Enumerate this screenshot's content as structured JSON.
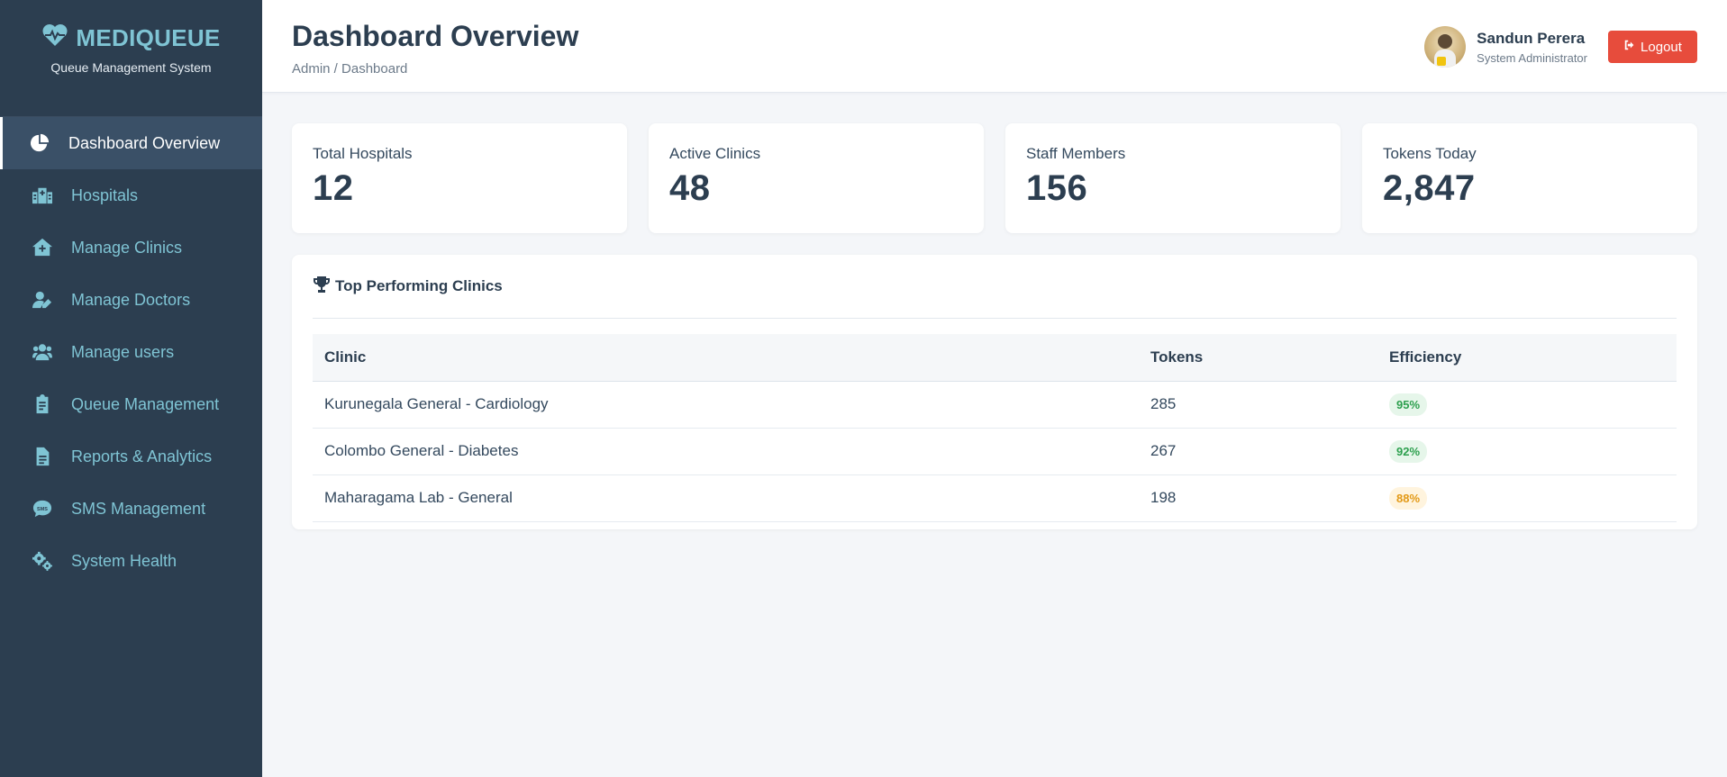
{
  "brand": {
    "name": "MEDIQUEUE",
    "subtitle": "Queue Management System",
    "icon": "heartbeat-icon"
  },
  "sidebar": {
    "items": [
      {
        "label": "Dashboard Overview",
        "icon": "pie-chart-icon",
        "active": true
      },
      {
        "label": "Hospitals",
        "icon": "hospital-icon",
        "active": false
      },
      {
        "label": "Manage Clinics",
        "icon": "clinic-plus-icon",
        "active": false
      },
      {
        "label": "Manage Doctors",
        "icon": "user-edit-icon",
        "active": false
      },
      {
        "label": "Manage users",
        "icon": "users-icon",
        "active": false
      },
      {
        "label": "Queue Management",
        "icon": "clipboard-icon",
        "active": false
      },
      {
        "label": "Reports & Analytics",
        "icon": "document-icon",
        "active": false
      },
      {
        "label": "SMS Management",
        "icon": "sms-bubble-icon",
        "active": false
      },
      {
        "label": "System Health",
        "icon": "gears-icon",
        "active": false
      }
    ]
  },
  "header": {
    "title": "Dashboard Overview",
    "breadcrumb": "Admin / Dashboard",
    "user": {
      "name": "Sandun Perera",
      "role": "System Administrator"
    },
    "logout_label": "Logout"
  },
  "stats": [
    {
      "label": "Total Hospitals",
      "value": "12"
    },
    {
      "label": "Active Clinics",
      "value": "48"
    },
    {
      "label": "Staff Members",
      "value": "156"
    },
    {
      "label": "Tokens Today",
      "value": "2,847"
    }
  ],
  "top_clinics": {
    "title": "Top Performing Clinics",
    "columns": [
      "Clinic",
      "Tokens",
      "Efficiency"
    ],
    "rows": [
      {
        "clinic": "Kurunegala General - Cardiology",
        "tokens": "285",
        "efficiency": "95%",
        "status": "good"
      },
      {
        "clinic": "Colombo General - Diabetes",
        "tokens": "267",
        "efficiency": "92%",
        "status": "good"
      },
      {
        "clinic": "Maharagama Lab - General",
        "tokens": "198",
        "efficiency": "88%",
        "status": "warn"
      }
    ]
  },
  "colors": {
    "sidebar_bg": "#2c3e50",
    "accent": "#7fc4d4",
    "logout": "#e74c3c",
    "success": "#2ea04f",
    "warning": "#e39a17"
  }
}
